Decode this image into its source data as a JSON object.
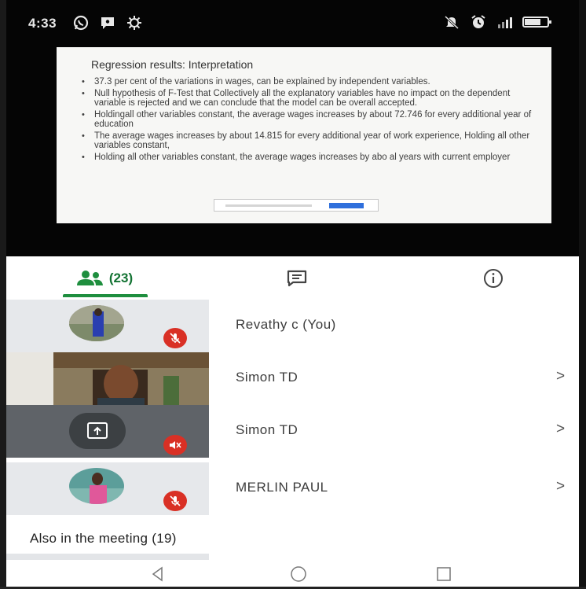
{
  "status_bar": {
    "time": "4:33",
    "left_icons": [
      "whatsapp-icon",
      "chat-bubble-icon",
      "settings-icon"
    ],
    "right_icons": [
      "mute-notifications-icon",
      "alarm-icon",
      "signal-icon",
      "battery-icon"
    ]
  },
  "slide": {
    "title": "Regression results: Interpretation",
    "bullets": [
      "37.3 per cent of the variations in wages, can be explained by independent variables.",
      "Null hypothesis of F-Test that Collectively all the explanatory variables have no impact on the dependent variable is rejected and we can conclude that the model can be overall accepted.",
      "Holdingall other variables constant, the average wages increases by about 72.746 for every additional year of education",
      "The average wages increases by about 14.815 for every additional year of work experience, Holding all other variables constant,",
      "Holding all other variables constant, the average wages increases by abo                      al years with current employer"
    ]
  },
  "tabs": {
    "people_count": "(23)",
    "people_icon": "people-icon",
    "chat_icon": "chat-icon",
    "info_icon": "info-icon"
  },
  "participants": [
    {
      "name": "Revathy c (You)",
      "muted": true,
      "chevron": ""
    },
    {
      "name": "Simon TD",
      "muted": false,
      "chevron": ">"
    },
    {
      "name": "Simon TD",
      "muted": true,
      "chevron": ">"
    },
    {
      "name": "MERLIN PAUL",
      "muted": true,
      "chevron": ">"
    }
  ],
  "also_in_meeting": "Also in the meeting (19)",
  "colors": {
    "accent_green": "#1e8e3e",
    "mute_red": "#d93025"
  }
}
